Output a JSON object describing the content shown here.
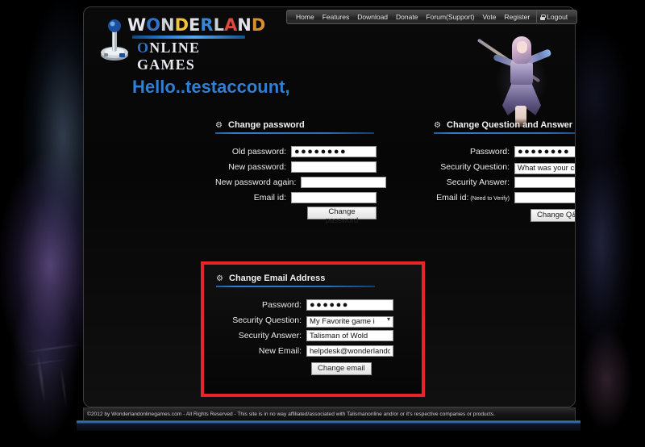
{
  "background": {
    "page_bg_color": "#000000",
    "panel_bg_color": "#0a0a0a",
    "accent_blue": "#2f7fd4",
    "highlight_red": "#e8232a"
  },
  "logo": {
    "icon": "joystick-icon",
    "word_letters": [
      "W",
      "O",
      "N",
      "D",
      "E",
      "R",
      "L",
      "A",
      "N",
      "D"
    ],
    "subtitle_first": "O",
    "subtitle_rest": "NLINE GAMES"
  },
  "topnav": {
    "items": [
      {
        "label": "Home",
        "name": "nav-home"
      },
      {
        "label": "Features",
        "name": "nav-features"
      },
      {
        "label": "Download",
        "name": "nav-download"
      },
      {
        "label": "Donate",
        "name": "nav-donate"
      },
      {
        "label": "Forum(Support)",
        "name": "nav-forum"
      },
      {
        "label": "Vote",
        "name": "nav-vote"
      },
      {
        "label": "Register",
        "name": "nav-register"
      }
    ],
    "logout_label": "Logout",
    "logout_icon": "lock-icon"
  },
  "greeting": {
    "text": "Hello..testaccount",
    "comma": ","
  },
  "sections": {
    "change_password": {
      "title": "Change password",
      "icon": "gear-icon",
      "rows": [
        {
          "label": "Old password:",
          "type": "password",
          "value": "●●●●●●●●",
          "name": "old-password-field"
        },
        {
          "label": "New password:",
          "type": "password",
          "value": "",
          "name": "new-password-field"
        },
        {
          "label": "New password again:",
          "type": "password",
          "value": "",
          "name": "new-password-again-field"
        },
        {
          "label": "Email id:",
          "type": "text",
          "value": "",
          "name": "email-id-field"
        }
      ],
      "button_label": "Change password"
    },
    "change_qa": {
      "title": "Change Question and Answer",
      "icon": "gear-icon",
      "rows": [
        {
          "label": "Password:",
          "type": "password",
          "value": "●●●●●●●●",
          "name": "qa-password-field"
        },
        {
          "label": "Security Question:",
          "type": "select",
          "value": "What was your chilc",
          "name": "qa-security-question-select"
        },
        {
          "label": "Security Answer:",
          "type": "text",
          "value": "",
          "name": "qa-security-answer-field"
        },
        {
          "label": "Email id:",
          "label_small": " (Need to Verify)",
          "type": "text",
          "value": "",
          "name": "qa-email-id-field"
        }
      ],
      "button_label": "Change Q&A"
    },
    "change_email": {
      "title": "Change Email Address",
      "icon": "gear-icon",
      "highlighted": true,
      "rows": [
        {
          "label": "Password:",
          "type": "password",
          "value": "●●●●●●",
          "name": "email-password-field"
        },
        {
          "label": "Security Question:",
          "type": "select",
          "value": "My Favorite game i",
          "name": "email-security-question-select"
        },
        {
          "label": "Security Answer:",
          "type": "text",
          "value": "Talisman of Wold",
          "name": "email-security-answer-field"
        },
        {
          "label": "New Email:",
          "type": "text",
          "value": "helpdesk@wonderlando",
          "name": "new-email-field"
        }
      ],
      "button_label": "Change email"
    }
  },
  "footer": {
    "text": "©2012 by Wonderlandonlinegames.com - All Rights Reserved - This site is in no way affiliated/associated with Talismanonline and/or or it's respective companies or products."
  }
}
